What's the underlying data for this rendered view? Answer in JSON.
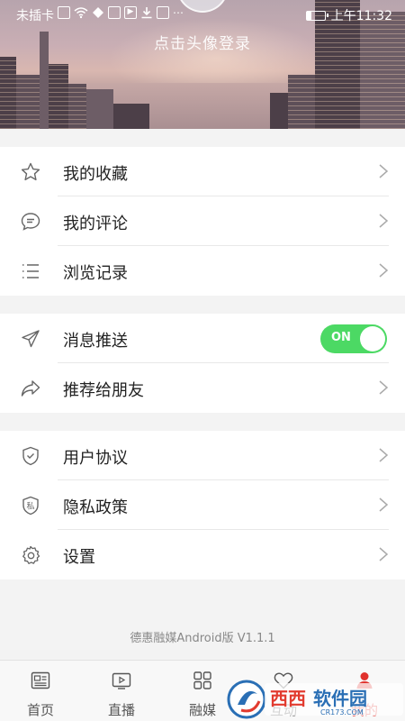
{
  "status_bar": {
    "carrier": "未插卡",
    "time": "上午11:32"
  },
  "profile": {
    "login_prompt": "点击头像登录"
  },
  "menu_groups": [
    {
      "items": [
        {
          "label": "我的收藏",
          "icon": "star-icon"
        },
        {
          "label": "我的评论",
          "icon": "comment-icon"
        },
        {
          "label": "浏览记录",
          "icon": "list-icon"
        }
      ]
    },
    {
      "items": [
        {
          "label": "消息推送",
          "icon": "send-icon",
          "toggle": {
            "state": "ON",
            "value": true
          }
        },
        {
          "label": "推荐给朋友",
          "icon": "share-icon"
        }
      ]
    },
    {
      "items": [
        {
          "label": "用户协议",
          "icon": "shield-check-icon"
        },
        {
          "label": "隐私政策",
          "icon": "shield-private-icon",
          "icon_text": "私"
        },
        {
          "label": "设置",
          "icon": "gear-icon"
        }
      ]
    }
  ],
  "version_text": "德惠融媒Android版 V1.1.1",
  "tabs": [
    {
      "label": "首页",
      "icon": "news-icon"
    },
    {
      "label": "直播",
      "icon": "live-video-icon"
    },
    {
      "label": "融媒",
      "icon": "grid-icon"
    },
    {
      "label": "互动",
      "icon": "heart-icon"
    },
    {
      "label": "我的",
      "icon": "profile-icon",
      "active": true
    }
  ],
  "watermark": {
    "text": "西西软件园",
    "sub": "CR173.COM"
  },
  "colors": {
    "toggle_on": "#4cd964",
    "active_tab": "#e0322d"
  }
}
